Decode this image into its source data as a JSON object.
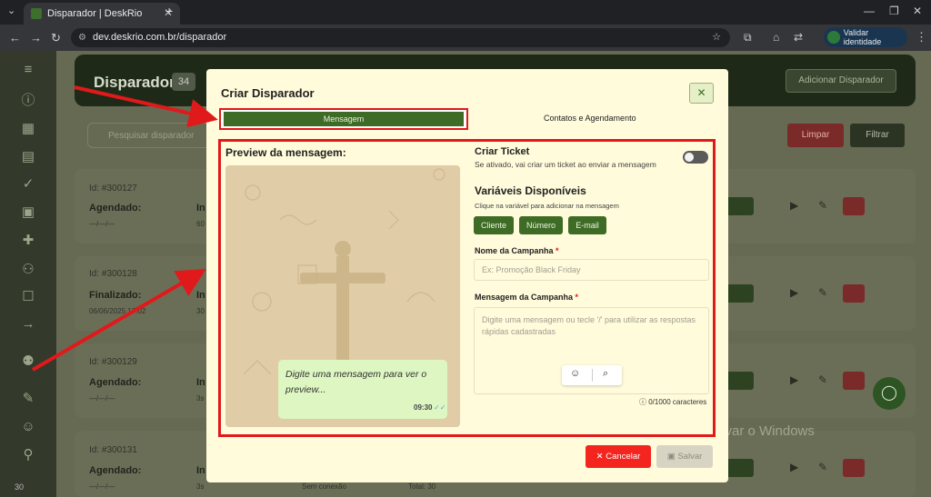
{
  "browser": {
    "tab_title": "Disparador | DeskRio",
    "url": "dev.deskrio.com.br/disparador",
    "validate_label": "Validar identidade"
  },
  "app": {
    "page_title": "Disparador",
    "count": "34",
    "add_button": "Adicionar Disparador",
    "search_placeholder": "Pesquisar disparador",
    "clear_button": "Limpar",
    "filter_button": "Filtrar",
    "sidebar_footer": "30",
    "cards": [
      {
        "id": "Id: #300127",
        "status": "Agendado:",
        "date": "—/—/—",
        "info": "In",
        "info2": "60"
      },
      {
        "id": "Id: #300128",
        "status": "Finalizado:",
        "date": "06/06/2025 17:02",
        "info": "In",
        "info2": "30"
      },
      {
        "id": "Id: #300129",
        "status": "Agendado:",
        "date": "—/—/—",
        "info": "In",
        "info2": "3s"
      },
      {
        "id": "Id: #300131",
        "status": "Agendado:",
        "date": "—/—/—",
        "info": "In",
        "info2": "3s",
        "extra1": "Sem conexão",
        "extra2": "Total: 30"
      }
    ]
  },
  "modal": {
    "title": "Criar Disparador",
    "tabs": {
      "message": "Mensagem",
      "contacts": "Contatos e Agendamento"
    },
    "preview_title": "Preview da mensagem:",
    "preview_bubble": "Digite uma mensagem para ver o preview...",
    "preview_time": "09:30",
    "ticket_label": "Criar Ticket",
    "ticket_desc": "Se ativado, vai criar um ticket ao enviar a mensagem",
    "ticket_enabled": false,
    "vars_title": "Variáveis Disponíveis",
    "vars_desc": "Clique na variável para adicionar na mensagem",
    "vars": [
      "Cliente",
      "Número",
      "E-mail"
    ],
    "campaign_name_label": "Nome da Campanha",
    "campaign_name_placeholder": "Ex: Promoção Black Friday",
    "campaign_message_label": "Mensagem da Campanha",
    "campaign_message_placeholder": "Digite uma mensagem ou tecle '/' para utilizar as respostas rápidas cadastradas",
    "char_counter": "0/1000 caracteres",
    "cancel_button": "Cancelar",
    "save_button": "Salvar"
  },
  "overlay": {
    "windows_watermark": "Ativar o Windows"
  },
  "colors": {
    "accent_green": "#3e6b25",
    "danger_red": "#f4241f",
    "highlight_red": "#e0191b",
    "modal_bg": "#fffbdb"
  }
}
